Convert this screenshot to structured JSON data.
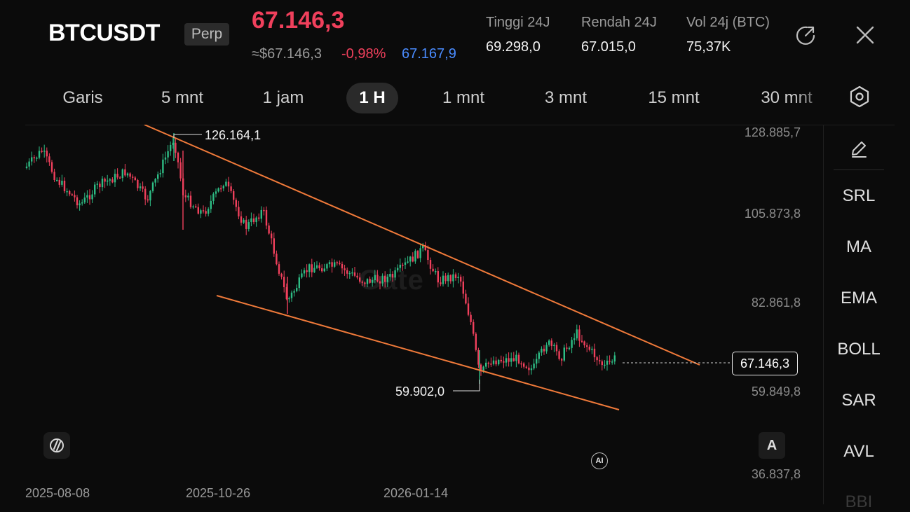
{
  "header": {
    "symbol": "BTCUSDT",
    "badge": "Perp",
    "last_price": "67.146,3",
    "usd_price": "≈$67.146,3",
    "change": "-0,98%",
    "mark_price": "67.167,9",
    "high_label": "Tinggi 24J",
    "high_value": "69.298,0",
    "low_label": "Rendah 24J",
    "low_value": "67.015,0",
    "vol_label": "Vol 24j (BTC)",
    "vol_value": "75,37K",
    "icons": [
      "share-icon",
      "close-icon"
    ]
  },
  "tabs": [
    "Garis",
    "5 mnt",
    "1 jam",
    "1 H",
    "1 mnt",
    "3 mnt",
    "15 mnt",
    "30 mnt"
  ],
  "active_tab": "1 H",
  "chart": {
    "price_ticks": [
      "128.885,7",
      "105.873,8",
      "82.861,8",
      "59.849,8",
      "36.837,8"
    ],
    "date_ticks": [
      "2025-08-08",
      "2025-10-26",
      "2026-01-14"
    ],
    "high_marker": "126.164,1",
    "low_marker": "59.902,0",
    "current_price": "67.146,3",
    "ai_label": "AI",
    "auto_label": "A",
    "watermark": "Gate"
  },
  "chart_data": {
    "type": "candlestick",
    "price_ticks": [
      128885.7,
      105873.8,
      82861.8,
      59849.8,
      36837.8
    ],
    "high": 126164.1,
    "low": 59902.0,
    "last": 67146.3,
    "trendlines": [
      {
        "name": "upper"
      },
      {
        "name": "lower"
      }
    ],
    "colors": {
      "up": "#2ebd85",
      "down": "#f0405c",
      "trendline": "#f07a3a"
    }
  },
  "indicators": [
    "SRL",
    "MA",
    "EMA",
    "BOLL",
    "SAR",
    "AVL",
    "BBI"
  ],
  "colors": {
    "accent_red": "#f0405c",
    "accent_blue": "#4a8cff",
    "background": "#0b0b0b"
  }
}
